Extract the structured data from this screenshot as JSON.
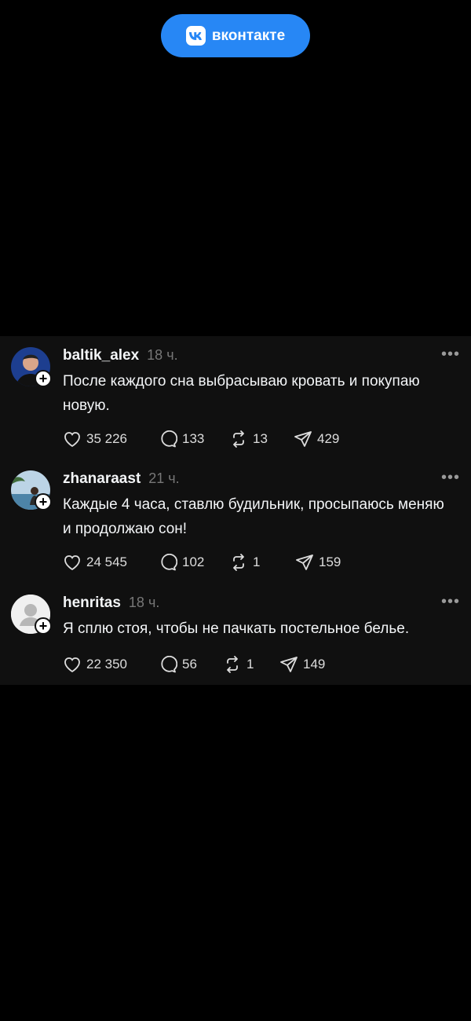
{
  "brand": {
    "label": "вконтакте",
    "icon": "vk-logo-icon",
    "color": "#2787f5"
  },
  "posts": [
    {
      "username": "baltik_alex",
      "time": "18 ч.",
      "text": "После каждого сна выбрасываю кровать и покупаю новую.",
      "likes": "35 226",
      "replies": "133",
      "reposts": "13",
      "shares": "429"
    },
    {
      "username": "zhanaraast",
      "time": "21 ч.",
      "text": "Каждые 4 часа, ставлю будильник, просыпаюсь меняю и продолжаю сон!",
      "likes": "24 545",
      "replies": "102",
      "reposts": "1",
      "shares": "159"
    },
    {
      "username": "henritas",
      "time": "18 ч.",
      "text": "Я сплю стоя, чтобы не пачкать постельное белье.",
      "likes": "22 350",
      "replies": "56",
      "reposts": "1",
      "shares": "149"
    }
  ]
}
